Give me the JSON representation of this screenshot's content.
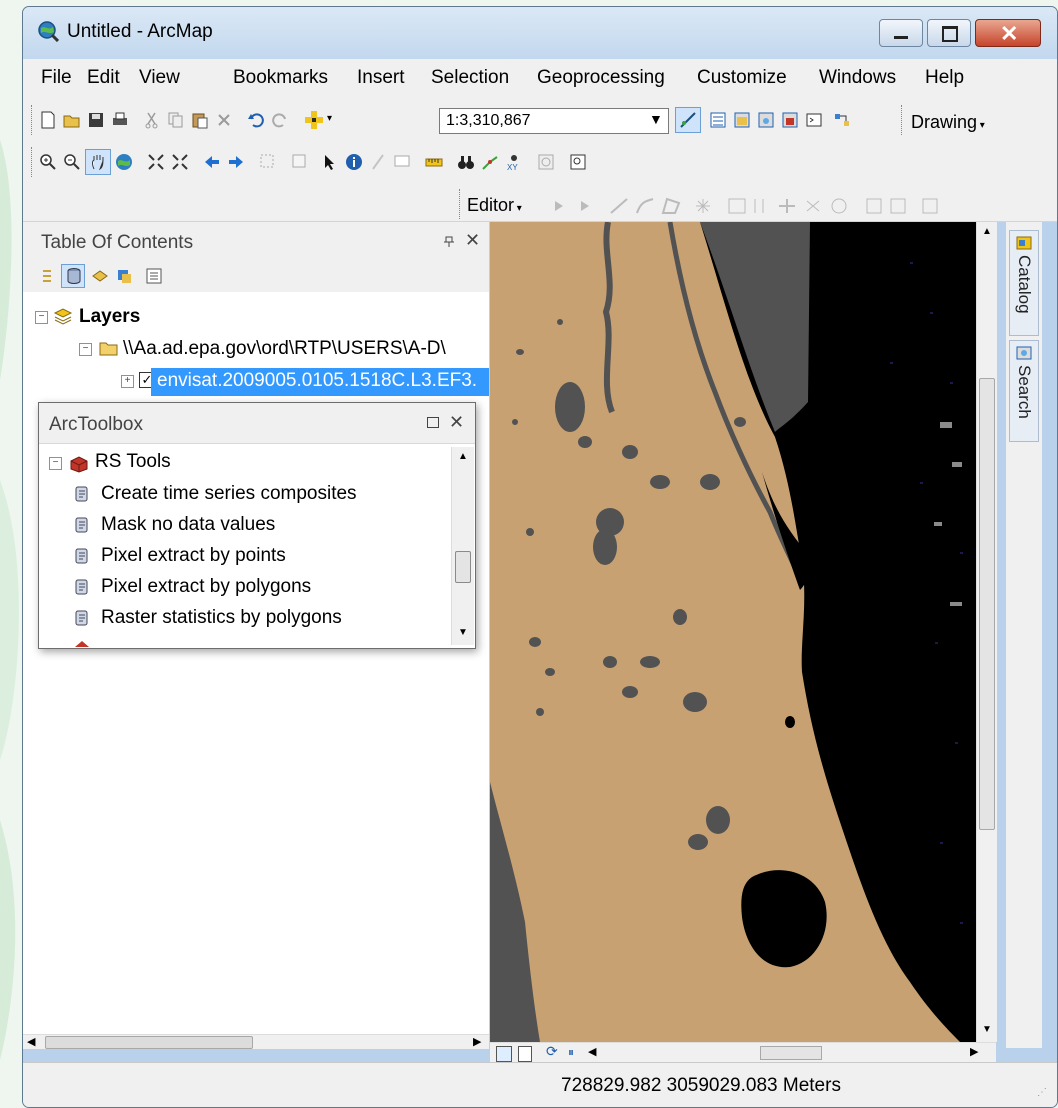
{
  "window": {
    "title": "Untitled - ArcMap",
    "controls": [
      "minimize",
      "maximize",
      "close"
    ]
  },
  "menubar": [
    "File",
    "Edit",
    "View",
    "Bookmarks",
    "Insert",
    "Selection",
    "Geoprocessing",
    "Customize",
    "Windows",
    "Help"
  ],
  "toolbar": {
    "scale": "1:3,310,867",
    "drawing_label": "Drawing",
    "editor_label": "Editor"
  },
  "toc": {
    "title": "Table Of Contents",
    "layers_label": "Layers",
    "folder_path": "\\\\Aa.ad.epa.gov\\ord\\RTP\\USERS\\A-D\\",
    "layer_name": "envisat.2009005.0105.1518C.L3.EF3."
  },
  "toolbox": {
    "title": "ArcToolbox",
    "group": "RS Tools",
    "tools": [
      "Create time series composites",
      "Mask no data values",
      "Pixel extract by points",
      "Pixel extract by polygons",
      "Raster statistics by polygons"
    ]
  },
  "sidetabs": [
    "Catalog",
    "Search"
  ],
  "status": {
    "coordinates": "728829.982  3059029.083 Meters"
  },
  "colors": {
    "land": "#c8a173",
    "water": "#525252",
    "ocean": "#000000",
    "selection": "#3399ff"
  }
}
